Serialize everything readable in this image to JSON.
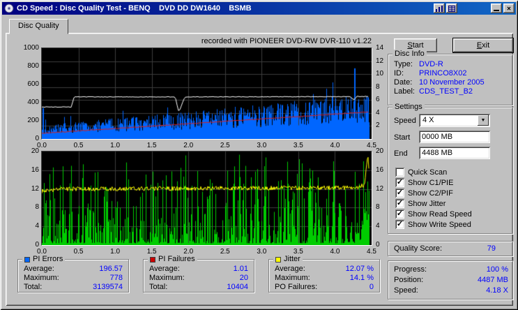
{
  "window": {
    "title": "CD Speed : Disc Quality Test - BENQ    DVD DD DW1640    BSMB",
    "tab_label": "Disc Quality"
  },
  "icons": {
    "close": "✕",
    "dropdown_arrow": "▼"
  },
  "header": {
    "recorded_with": "recorded with PIONEER DVD-RW  DVR-110  v1.22"
  },
  "actions": {
    "start": "Start",
    "exit": "Exit"
  },
  "disc_info": {
    "legend": "Disc Info",
    "rows": [
      {
        "label": "Type:",
        "value": "DVD-R"
      },
      {
        "label": "ID:",
        "value": "PRINCO8X02"
      },
      {
        "label": "Date:",
        "value": "10 November 2005"
      },
      {
        "label": "Label:",
        "value": "CDS_TEST_B2"
      }
    ]
  },
  "settings": {
    "legend": "Settings",
    "speed": {
      "label": "Speed",
      "value": "4 X"
    },
    "start": {
      "label": "Start",
      "value": "0000 MB"
    },
    "end": {
      "label": "End",
      "value": "4488 MB"
    },
    "checkboxes": [
      {
        "label": "Quick Scan",
        "checked": false,
        "mark": ""
      },
      {
        "label": "Show C1/PIE",
        "checked": true,
        "mark": "✓"
      },
      {
        "label": "Show C2/PIF",
        "checked": true,
        "mark": "✓"
      },
      {
        "label": "Show Jitter",
        "checked": true,
        "mark": "✓"
      },
      {
        "label": "Show Read Speed",
        "checked": true,
        "mark": "✓"
      },
      {
        "label": "Show Write Speed",
        "checked": true,
        "mark": "✓"
      }
    ]
  },
  "quality_score": {
    "label": "Quality Score:",
    "value": "79"
  },
  "progress_panel": {
    "rows": [
      {
        "label": "Progress:",
        "value": "100 %"
      },
      {
        "label": "Position:",
        "value": "4487 MB"
      },
      {
        "label": "Speed:",
        "value": "4.18 X"
      }
    ]
  },
  "legend_boxes": [
    {
      "title": "PI Errors",
      "color": "#0066ff",
      "rows": [
        {
          "label": "Average:",
          "value": "196.57"
        },
        {
          "label": "Maximum:",
          "value": "778"
        },
        {
          "label": "Total:",
          "value": "3139574"
        }
      ]
    },
    {
      "title": "PI Failures",
      "color": "#cc0000",
      "rows": [
        {
          "label": "Average:",
          "value": "1.01"
        },
        {
          "label": "Maximum:",
          "value": "20"
        },
        {
          "label": "Total:",
          "value": "10404"
        }
      ]
    },
    {
      "title": "Jitter",
      "color": "#ffff00",
      "rows": [
        {
          "label": "Average:",
          "value": "12.07 %"
        },
        {
          "label": "Maximum:",
          "value": "14.1 %"
        },
        {
          "label": "PO Failures:",
          "value": "0"
        }
      ]
    }
  ],
  "chart_data": [
    {
      "type": "area",
      "name": "pi-errors-and-speed",
      "x_range": [
        0,
        4.5
      ],
      "x_ticks": [
        "0.0",
        "0.5",
        "1.0",
        "1.5",
        "2.0",
        "2.5",
        "3.0",
        "3.5",
        "4.0",
        "4.5"
      ],
      "y_left": {
        "range": [
          0,
          1000
        ],
        "ticks": [
          "1000",
          "800",
          "600",
          "400",
          "200",
          "0"
        ]
      },
      "y_right": {
        "range": [
          0,
          14
        ],
        "ticks": [
          "14",
          "12",
          "10",
          "8",
          "6",
          "4",
          "2"
        ]
      },
      "data_end_x": 4.47,
      "series": [
        {
          "name": "PI Errors",
          "color": "#0066ff",
          "style": "noisy-area",
          "trend": [
            [
              0,
              130
            ],
            [
              1,
              200
            ],
            [
              2,
              260
            ],
            [
              3,
              330
            ],
            [
              4,
              410
            ],
            [
              4.3,
              430
            ],
            [
              4.47,
              420
            ]
          ],
          "spikes": [
            [
              0.02,
              340
            ],
            [
              4.27,
              778
            ]
          ]
        },
        {
          "name": "Read Speed",
          "color": "#ffffff",
          "style": "line",
          "points": [
            [
              0,
              352
            ],
            [
              0.4,
              352
            ],
            [
              0.44,
              463
            ],
            [
              1.82,
              463
            ],
            [
              1.87,
              292
            ],
            [
              1.95,
              463
            ],
            [
              4.2,
              466
            ],
            [
              4.26,
              432
            ],
            [
              4.3,
              468
            ],
            [
              4.47,
              468
            ]
          ]
        },
        {
          "name": "Write Speed",
          "color": "#d82020",
          "style": "line",
          "points": [
            [
              0,
              62
            ],
            [
              4.47,
              298
            ]
          ]
        }
      ]
    },
    {
      "type": "bar",
      "name": "pi-failures-and-jitter",
      "x_range": [
        0,
        4.5
      ],
      "x_ticks": [
        "0.0",
        "0.5",
        "1.0",
        "1.5",
        "2.0",
        "2.5",
        "3.0",
        "3.5",
        "4.0",
        "4.5"
      ],
      "y_left": {
        "range": [
          0,
          20
        ],
        "ticks": [
          "20",
          "16",
          "12",
          "8",
          "4",
          "0"
        ]
      },
      "y_right": {
        "range": [
          0,
          20
        ],
        "ticks": [
          "20",
          "16",
          "12",
          "8",
          "4",
          "0"
        ]
      },
      "data_end_x": 4.47,
      "series": [
        {
          "name": "PI Failures",
          "color": "#00cc00",
          "style": "noisy-spikes",
          "typical_max": 13,
          "end_burst": [
            4.33,
            20
          ]
        },
        {
          "name": "Jitter",
          "color": "#ffff00",
          "style": "noisy-line",
          "noise": 0.9,
          "trend": [
            [
              0,
              11.5
            ],
            [
              0.25,
              12.0
            ],
            [
              2.0,
              12.1
            ],
            [
              4.3,
              12.3
            ],
            [
              4.4,
              12.8
            ],
            [
              4.45,
              19.0
            ],
            [
              4.47,
              15.0
            ]
          ]
        }
      ]
    }
  ]
}
